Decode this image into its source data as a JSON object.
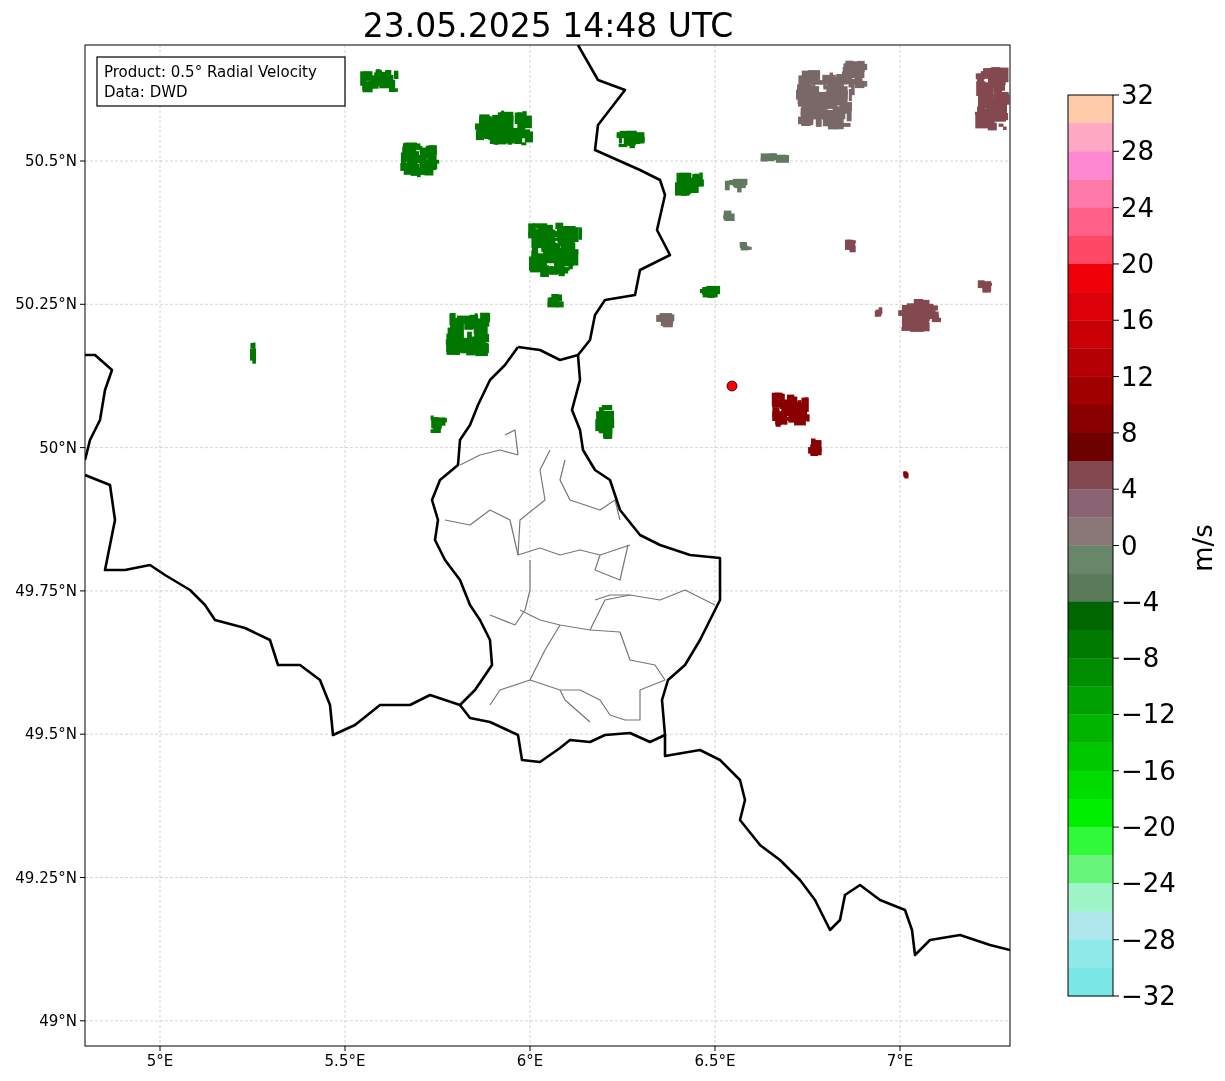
{
  "title": "23.05.2025 14:48 UTC",
  "map": {
    "info_box": [
      "Product: 0.5° Radial Velocity",
      "Data: DWD"
    ],
    "lat_labels": [
      "50.5°N",
      "50.25°N",
      "50°N",
      "49.75°N",
      "49.5°N",
      "49.25°N",
      "49°N"
    ],
    "lon_labels": [
      "5°E",
      "5.5°E",
      "6°E",
      "6.5°E",
      "7°E"
    ]
  },
  "colorbar": {
    "label": "m/s",
    "ticks": [
      "32",
      "28",
      "24",
      "20",
      "16",
      "12",
      "8",
      "4",
      "0",
      "−4",
      "−8",
      "−12",
      "−16",
      "−20",
      "−24",
      "−28",
      "−32"
    ],
    "bands": [
      {
        "color": "#ffcba8"
      },
      {
        "color": "#ffa8c4"
      },
      {
        "color": "#ff88d0"
      },
      {
        "color": "#ff7aa8"
      },
      {
        "color": "#ff6088"
      },
      {
        "color": "#ff4866"
      },
      {
        "color": "#f00008"
      },
      {
        "color": "#dc0008"
      },
      {
        "color": "#c80006"
      },
      {
        "color": "#b40004"
      },
      {
        "color": "#a00000"
      },
      {
        "color": "#8a0000"
      },
      {
        "color": "#6e0000"
      },
      {
        "color": "#844850"
      },
      {
        "color": "#8a6472"
      },
      {
        "color": "#8a7878"
      },
      {
        "color": "#6a866a"
      },
      {
        "color": "#5a7a5a"
      },
      {
        "color": "#006600"
      },
      {
        "color": "#007a00"
      },
      {
        "color": "#008c00"
      },
      {
        "color": "#00a000"
      },
      {
        "color": "#00b400"
      },
      {
        "color": "#00c800"
      },
      {
        "color": "#00dc00"
      },
      {
        "color": "#00f000"
      },
      {
        "color": "#30f83a"
      },
      {
        "color": "#66f57a"
      },
      {
        "color": "#9df5c8"
      },
      {
        "color": "#aee8ec"
      },
      {
        "color": "#90eaea"
      },
      {
        "color": "#7ae6e6"
      }
    ]
  }
}
